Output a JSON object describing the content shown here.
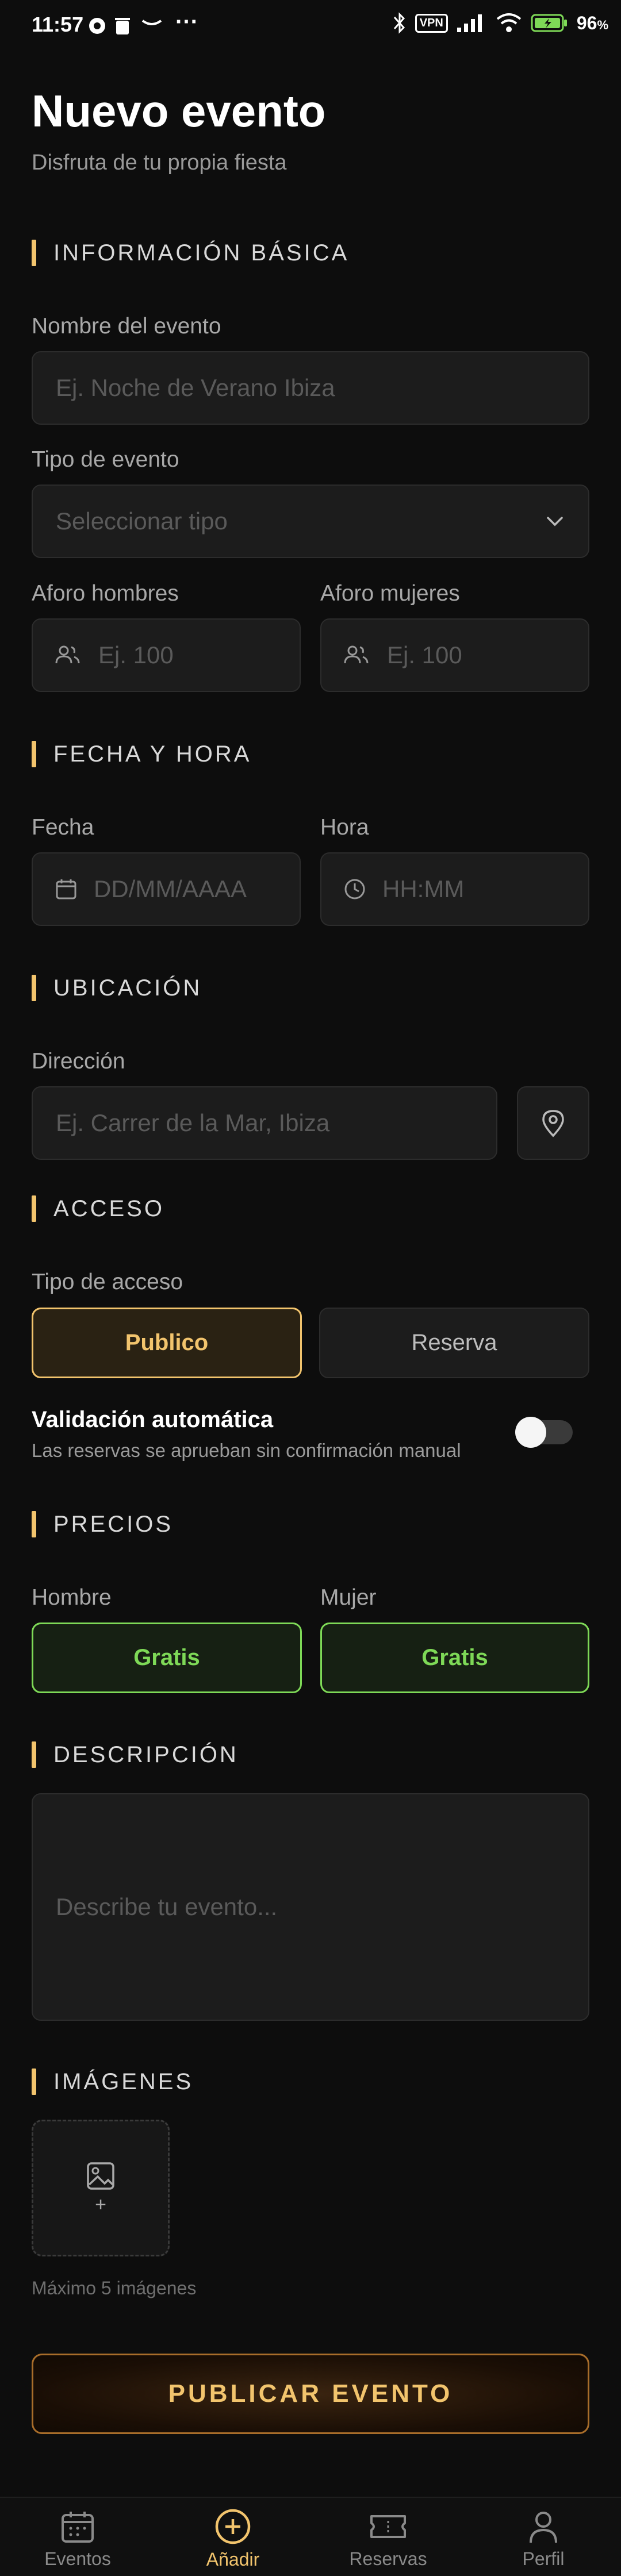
{
  "status_bar": {
    "time": "11:57",
    "dots": "···",
    "vpn": "VPN",
    "battery": "96"
  },
  "header": {
    "title": "Nuevo evento",
    "subtitle": "Disfruta de tu propia fiesta"
  },
  "sections": {
    "basic": "INFORMACIÓN BÁSICA",
    "datetime": "FECHA Y HORA",
    "location": "UBICACIÓN",
    "access": "ACCESO",
    "prices": "PRECIOS",
    "description": "DESCRIPCIÓN",
    "images": "IMÁGENES"
  },
  "form": {
    "event_name": {
      "label": "Nombre del evento",
      "placeholder": "Ej. Noche de Verano Ibiza"
    },
    "event_type": {
      "label": "Tipo de evento",
      "placeholder": "Seleccionar tipo"
    },
    "capacity_men": {
      "label": "Aforo hombres",
      "placeholder": "Ej. 100"
    },
    "capacity_women": {
      "label": "Aforo mujeres",
      "placeholder": "Ej. 100"
    },
    "date": {
      "label": "Fecha",
      "placeholder": "DD/MM/AAAA"
    },
    "time": {
      "label": "Hora",
      "placeholder": "HH:MM"
    },
    "address": {
      "label": "Dirección",
      "placeholder": "Ej. Carrer de la Mar, Ibiza"
    },
    "access_type": {
      "label": "Tipo de acceso",
      "options": [
        "Publico",
        "Reserva"
      ],
      "selected": "Publico"
    },
    "auto_validation": {
      "label": "Validación automática",
      "hint": "Las reservas se aprueban sin confirmación manual",
      "enabled": false
    },
    "price_men": {
      "label": "Hombre",
      "value": "Gratis"
    },
    "price_women": {
      "label": "Mujer",
      "value": "Gratis"
    },
    "description": {
      "placeholder": "Describe tu evento..."
    },
    "images": {
      "plus": "+",
      "hint": "Máximo 5 imágenes"
    }
  },
  "publish_button": "PUBLICAR EVENTO",
  "bottom_nav": [
    {
      "label": "Eventos",
      "icon": "calendar-icon",
      "active": false
    },
    {
      "label": "Añadir",
      "icon": "plus-circle-icon",
      "active": true
    },
    {
      "label": "Reservas",
      "icon": "ticket-icon",
      "active": false
    },
    {
      "label": "Perfil",
      "icon": "user-icon",
      "active": false
    }
  ],
  "colors": {
    "accent": "#f2c46d",
    "green": "#7ed957",
    "background": "#0d0d0d",
    "field": "#1c1c1c"
  }
}
